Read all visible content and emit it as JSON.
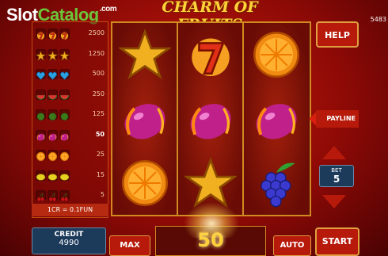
{
  "watermark": {
    "part1": "Slot",
    "part2": "Catalog",
    "suffix": ".com"
  },
  "game": {
    "title": "CHARM OF FRUITS",
    "score_readout": "5483"
  },
  "paytable": {
    "rows": [
      {
        "symbol": "seven-icon",
        "value": "2500",
        "highlight": false
      },
      {
        "symbol": "star-icon",
        "value": "1250",
        "highlight": false
      },
      {
        "symbol": "heart-gem-icon",
        "value": "500",
        "highlight": false
      },
      {
        "symbol": "watermelon-icon",
        "value": "250",
        "highlight": false
      },
      {
        "symbol": "green-fruit-icon",
        "value": "125",
        "highlight": false
      },
      {
        "symbol": "plum-icon",
        "value": "50",
        "highlight": true
      },
      {
        "symbol": "orange-icon",
        "value": "25",
        "highlight": false
      },
      {
        "symbol": "lemon-icon",
        "value": "15",
        "highlight": false
      },
      {
        "symbol": "cherry-icon",
        "value": "5",
        "highlight": false
      }
    ],
    "rate": "1CR = 0.1FUN"
  },
  "reels": [
    [
      "star-icon",
      "plum-icon",
      "orange-icon"
    ],
    [
      "seven-icon",
      "plum-icon",
      "star-icon"
    ],
    [
      "orange-icon",
      "plum-icon",
      "grapes-icon"
    ]
  ],
  "controls": {
    "help": "HELP",
    "payline": "PAYLINE",
    "bet_label": "BET",
    "bet_value": "5",
    "credit_label": "CREDIT",
    "credit_value": "4990",
    "max": "MAX",
    "win_amount": "50",
    "auto": "AUTO",
    "start": "START"
  },
  "colors": {
    "seven-icon": "#e23018",
    "star-icon": "#f0b020",
    "heart-gem-icon": "#2aa0e0",
    "watermelon-icon": "#2f8a2a",
    "green-fruit-icon": "#3c7a1c",
    "plum-icon": "#c0208a",
    "orange-icon": "#f08a10",
    "lemon-icon": "#e8d020",
    "cherry-icon": "#c81018"
  }
}
